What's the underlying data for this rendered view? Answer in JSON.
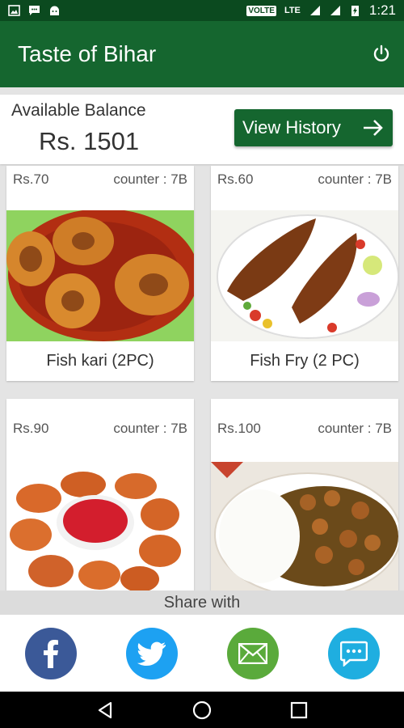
{
  "status_bar": {
    "tag": "VOLTE",
    "network": "LTE",
    "time": "1:21",
    "icons": [
      "image-icon",
      "chat-icon",
      "android-icon",
      "signal-icon",
      "battery-icon"
    ]
  },
  "app_bar": {
    "title": "Taste of Bihar",
    "power_icon": "power-icon"
  },
  "balance": {
    "label": "Available Balance",
    "value": "Rs. 1501",
    "history_label": "View History",
    "history_icon": "arrow-right-icon"
  },
  "menu_items": [
    {
      "price": "Rs.70",
      "counter": "counter : 7B",
      "name": "Fish kari (2PC)"
    },
    {
      "price": "Rs.60",
      "counter": "counter : 7B",
      "name": "Fish Fry (2 PC)"
    },
    {
      "price": "Rs.90",
      "counter": "counter : 7B",
      "name": ""
    },
    {
      "price": "Rs.100",
      "counter": "counter : 7B",
      "name": ""
    }
  ],
  "share": {
    "label": "Share with",
    "buttons": [
      {
        "icon": "facebook-icon",
        "color": "#3b5998"
      },
      {
        "icon": "twitter-icon",
        "color": "#1da1f2"
      },
      {
        "icon": "email-icon",
        "color": "#5aaa3b"
      },
      {
        "icon": "message-icon",
        "color": "#1faee0"
      }
    ]
  },
  "nav": [
    "back-icon",
    "home-icon",
    "recents-icon"
  ],
  "colors": {
    "primary": "#15662f",
    "primary_dark": "#0b4a1f"
  }
}
